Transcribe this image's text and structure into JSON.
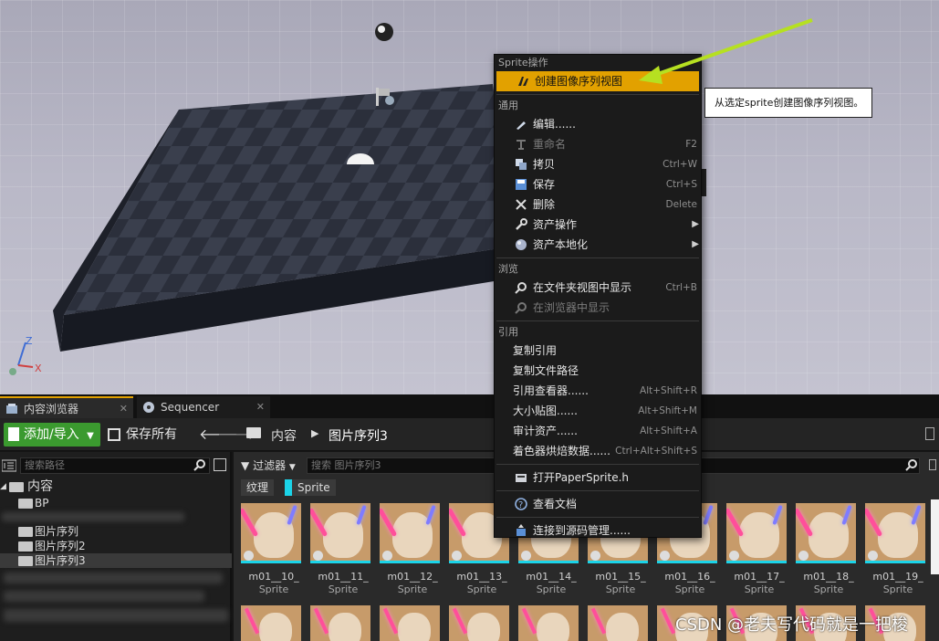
{
  "context_menu": {
    "sections": {
      "sprite_actions": "Sprite操作",
      "common": "通用",
      "browse": "浏览",
      "references": "引用"
    },
    "items": {
      "create_flipbook": "创建图像序列视图",
      "edit": "编辑......",
      "rename": "重命名",
      "rename_sc": "F2",
      "duplicate": "拷贝",
      "duplicate_sc": "Ctrl+W",
      "save": "保存",
      "save_sc": "Ctrl+S",
      "delete": "删除",
      "delete_sc": "Delete",
      "asset_actions": "资产操作",
      "asset_localization": "资产本地化",
      "show_in_folder": "在文件夹视图中显示",
      "show_in_folder_sc": "Ctrl+B",
      "show_in_explorer": "在浏览器中显示",
      "copy_reference": "复制引用",
      "copy_file_path": "复制文件路径",
      "reference_viewer": "引用查看器......",
      "reference_viewer_sc": "Alt+Shift+R",
      "size_map": "大小贴图......",
      "size_map_sc": "Alt+Shift+M",
      "audit_assets": "审计资产......",
      "audit_assets_sc": "Alt+Shift+A",
      "shader_cook": "着色器烘焙数据......",
      "shader_cook_sc": "Ctrl+Alt+Shift+S",
      "open_source": "打开PaperSprite.h",
      "view_docs": "查看文档",
      "connect_scm": "连接到源码管理......"
    }
  },
  "tooltip": "从选定sprite创建图像序列视图。",
  "tabs": {
    "content_browser": "内容浏览器",
    "sequencer": "Sequencer"
  },
  "toolbar": {
    "add_import": "添加/导入",
    "save_all": "保存所有",
    "breadcrumb": [
      "内容",
      "图片序列3"
    ]
  },
  "left_panel": {
    "search_placeholder": "搜索路径",
    "tree": [
      "内容",
      "BP",
      "图片序列",
      "图片序列2",
      "图片序列3"
    ]
  },
  "right_panel": {
    "filters_label": "过滤器",
    "search_placeholder": "搜索 图片序列3",
    "chips": [
      {
        "label": "纹理",
        "color": "#3a3a3a"
      },
      {
        "label": "Sprite",
        "color": "#1bd3e8"
      }
    ],
    "assets": [
      {
        "name": "m01__10_",
        "type": "Sprite"
      },
      {
        "name": "m01__11_",
        "type": "Sprite"
      },
      {
        "name": "m01__12_",
        "type": "Sprite"
      },
      {
        "name": "m01__13_",
        "type": "Sprite"
      },
      {
        "name": "m01__14_",
        "type": "Sprite"
      },
      {
        "name": "m01__15_",
        "type": "Sprite"
      },
      {
        "name": "m01__16_",
        "type": "Sprite"
      },
      {
        "name": "m01__17_",
        "type": "Sprite"
      },
      {
        "name": "m01__18_",
        "type": "Sprite"
      },
      {
        "name": "m01__19_",
        "type": "Sprite"
      }
    ]
  },
  "watermark": "CSDN @老夫写代码就是一把梭",
  "colors": {
    "highlight": "#e2a100",
    "add_button": "#3b9a2f",
    "sprite_chip": "#1bd3e8",
    "annotation_arrow": "#b6e021"
  }
}
